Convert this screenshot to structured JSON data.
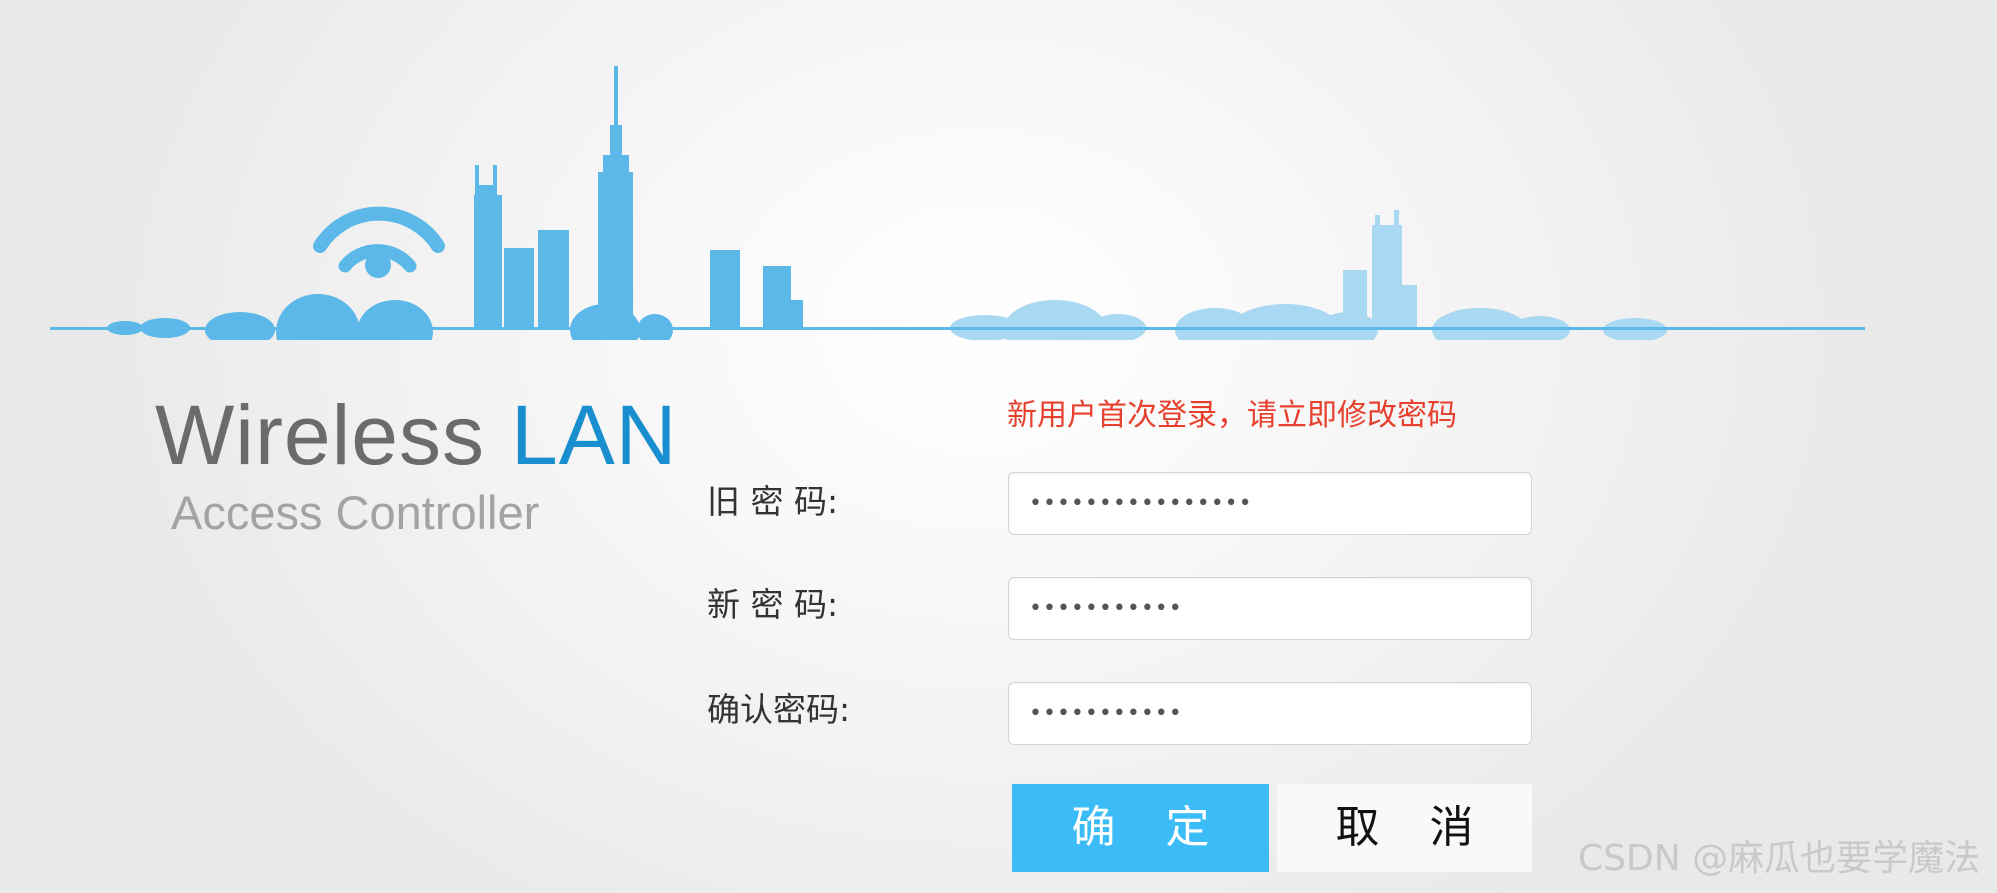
{
  "brand": {
    "title_word1": "Wireless",
    "title_word2": "LAN",
    "subtitle": "Access Controller"
  },
  "form": {
    "notice": "新用户首次登录，请立即修改密码",
    "fields": [
      {
        "label": "旧 密 码:",
        "masked_value": "••••••••••••••••"
      },
      {
        "label": "新 密 码:",
        "masked_value": "•••••••••••"
      },
      {
        "label": "确认密码:",
        "masked_value": "•••••••••••"
      }
    ],
    "confirm_label": "确 定",
    "cancel_label": "取 消"
  },
  "watermark": "CSDN @麻瓜也要学魔法",
  "icons": {
    "skyline": "city-skyline-icon",
    "wifi": "wifi-icon"
  },
  "colors": {
    "accent_blue": "#3cbcf7",
    "brand_blue": "#1a8fd0",
    "skyline_blue": "#5bb8e8",
    "notice_red": "#e8402e",
    "title_gray": "#6b6b6b",
    "subtitle_gray": "#a3a3a3"
  }
}
